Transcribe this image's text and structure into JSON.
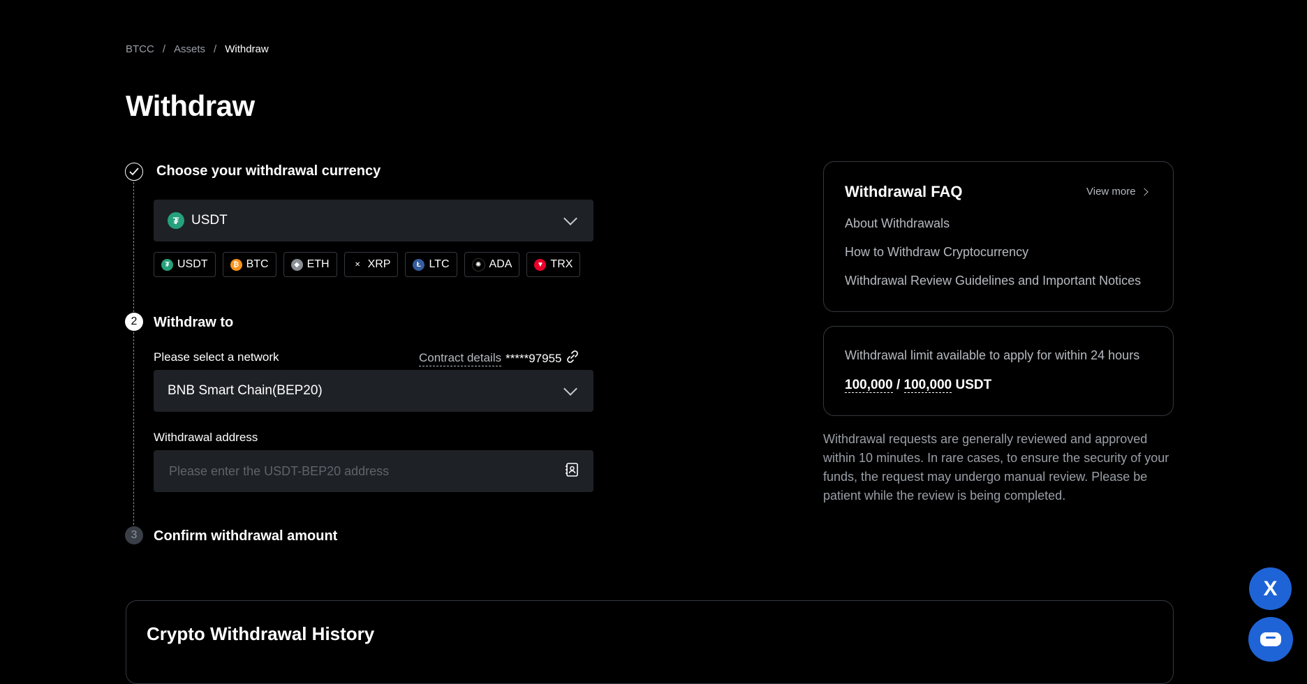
{
  "breadcrumb": {
    "items": [
      "BTCC",
      "Assets",
      "Withdraw"
    ],
    "separator": "/"
  },
  "page": {
    "title": "Withdraw"
  },
  "steps": {
    "step1": {
      "title": "Choose your withdrawal currency"
    },
    "step2": {
      "number": "2",
      "title": "Withdraw to"
    },
    "step3": {
      "number": "3",
      "title": "Confirm withdrawal amount"
    }
  },
  "currency": {
    "selected": "USDT",
    "options": [
      {
        "label": "USDT",
        "symbol": "₮",
        "color": "#26a17b"
      },
      {
        "label": "BTC",
        "symbol": "₿",
        "color": "#f7931a"
      },
      {
        "label": "ETH",
        "symbol": "◆",
        "color": "#8a8f96"
      },
      {
        "label": "XRP",
        "symbol": "✕",
        "color": "#000000"
      },
      {
        "label": "LTC",
        "symbol": "Ł",
        "color": "#345d9d"
      },
      {
        "label": "ADA",
        "symbol": "✺",
        "color": "#0033ad"
      },
      {
        "label": "TRX",
        "symbol": "▼",
        "color": "#eb0029"
      }
    ]
  },
  "network": {
    "label": "Please select a network",
    "contract_link": "Contract details",
    "contract_value": "*****97955",
    "selected": "BNB Smart Chain(BEP20)"
  },
  "address": {
    "label": "Withdrawal address",
    "placeholder": "Please enter the USDT-BEP20 address",
    "value": ""
  },
  "faq": {
    "title": "Withdrawal FAQ",
    "view_more": "View more",
    "items": [
      "About Withdrawals",
      "How to Withdraw Cryptocurrency",
      "Withdrawal Review Guidelines and Important Notices"
    ]
  },
  "limit": {
    "text": "Withdrawal limit available to apply for within 24 hours",
    "available": "100,000",
    "separator": "/",
    "total": "100,000",
    "unit": "USDT"
  },
  "notice": "Withdrawal requests are generally reviewed and approved within 10 minutes. In rare cases, to ensure the security of your funds, the request may undergo manual review. Please be patient while the review is being completed.",
  "history": {
    "title": "Crypto Withdrawal History"
  },
  "float": {
    "x_label": "X"
  },
  "colors": {
    "background": "#000000",
    "field": "#1e2126",
    "accent": "#1f64d6",
    "border": "#34383e"
  }
}
